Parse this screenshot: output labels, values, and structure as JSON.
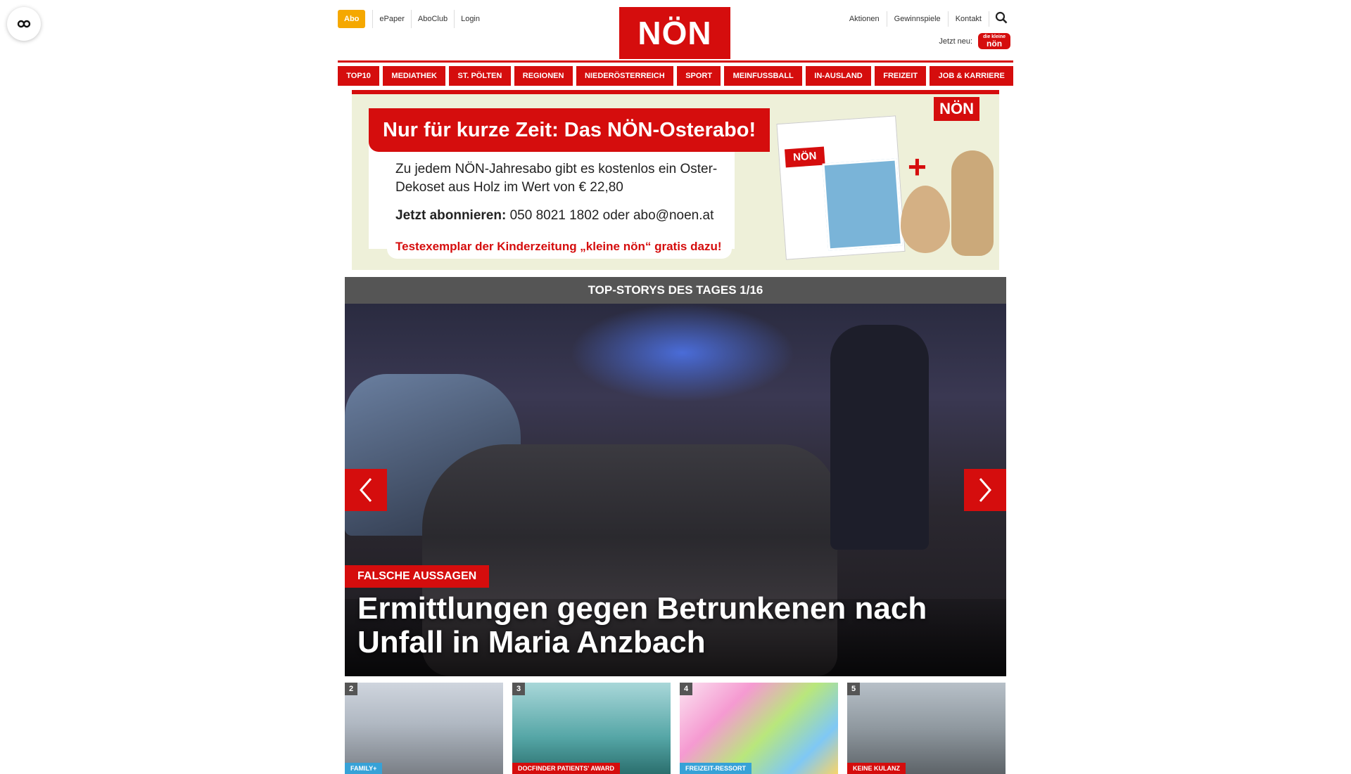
{
  "header": {
    "abo": "Abo",
    "epaper": "ePaper",
    "aboclub": "AboClub",
    "login": "Login",
    "logo": "NÖN",
    "aktionen": "Aktionen",
    "gewinnspiele": "Gewinnspiele",
    "kontakt": "Kontakt",
    "jetzt_neu": "Jetzt neu:",
    "kleine_logo_small": "die kleine",
    "kleine_logo": "nön"
  },
  "nav": {
    "items": [
      "TOP10",
      "MEDIATHEK",
      "ST. PÖLTEN",
      "REGIONEN",
      "NIEDERÖSTERREICH",
      "SPORT",
      "MEINFUSSBALL",
      "IN-AUSLAND",
      "FREIZEIT",
      "JOB & KARRIERE"
    ]
  },
  "ad": {
    "headline": "Nur für kurze Zeit: Das NÖN-Osterabo!",
    "text": "Zu jedem NÖN-Jahresabo gibt es kostenlos ein Oster-Dekoset aus Holz im Wert von € 22,80",
    "cta_label": "Jetzt abonnieren:",
    "cta_contact": "050 8021 1802 oder abo@noen.at",
    "free_line": "Testexemplar der Kinderzeitung „kleine nön“ gratis dazu!",
    "logo": "NÖN",
    "mag_logo": "NÖN"
  },
  "stories": {
    "heading": "TOP-STORYS DES TAGES 1/16",
    "hero": {
      "kicker": "FALSCHE AUSSAGEN",
      "title": "Ermittlungen gegen Betrunkenen nach Unfall in Maria Anzbach"
    },
    "thumbs": [
      {
        "num": "2",
        "tag": "FAMILY+"
      },
      {
        "num": "3",
        "tag": "DOCFINDER PATIENTS' AWARD"
      },
      {
        "num": "4",
        "tag": "FREIZEIT-RESSORT"
      },
      {
        "num": "5",
        "tag": "KEINE KULANZ"
      }
    ]
  },
  "colors": {
    "brand_red": "#d50d0d",
    "abo_orange": "#f5a800",
    "heading_gray": "#555555"
  }
}
